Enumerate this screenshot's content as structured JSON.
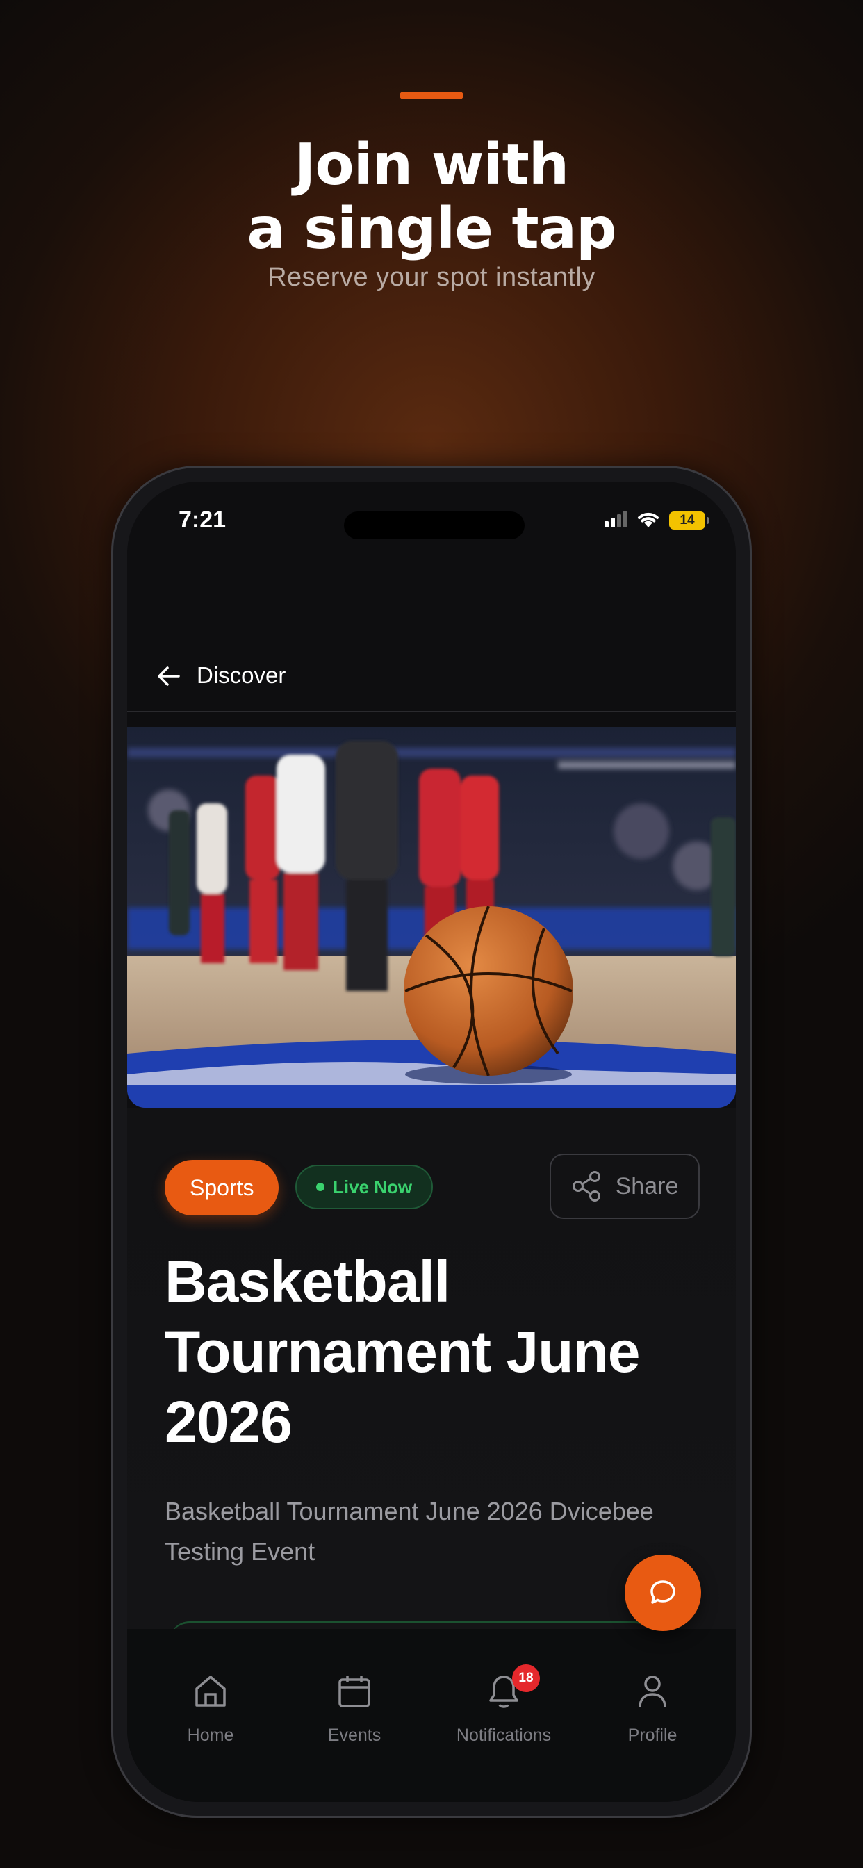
{
  "promo": {
    "headline_line1": "Join with",
    "headline_line2": "a single tap",
    "subheadline": "Reserve your spot instantly"
  },
  "status_bar": {
    "time": "7:21",
    "battery": "14"
  },
  "topbar": {
    "title": "Discover"
  },
  "event": {
    "category_badge": "Sports",
    "status_badge": "Live Now",
    "share_label": "Share",
    "title": "Basketball Tournament June 2026",
    "description": "Basketball Tournament June 2026 Dvicebee Testing Event"
  },
  "bottom_nav": {
    "items": [
      {
        "label": "Home",
        "icon": "home-icon"
      },
      {
        "label": "Events",
        "icon": "calendar-icon"
      },
      {
        "label": "Notifications",
        "icon": "bell-icon",
        "badge": "18"
      },
      {
        "label": "Profile",
        "icon": "user-icon"
      }
    ]
  },
  "colors": {
    "accent": "#e85a12",
    "live_green": "#3ad26e",
    "badge_red": "#e5282c"
  }
}
